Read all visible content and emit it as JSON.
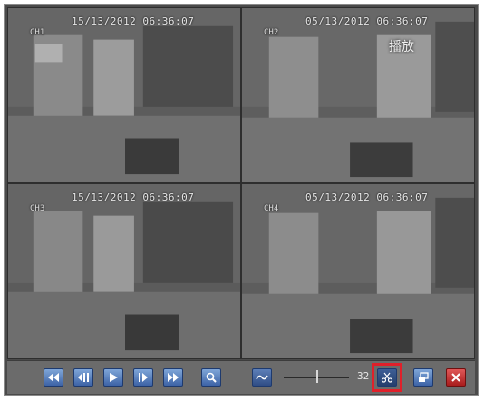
{
  "tiles": [
    {
      "timestamp": "15/13/2012 06:36:07",
      "channel": "CH1",
      "overlay_label": ""
    },
    {
      "timestamp": "05/13/2012 06:36:07",
      "channel": "CH2",
      "overlay_label": "播放"
    },
    {
      "timestamp": "15/13/2012 06:36:07",
      "channel": "CH3",
      "overlay_label": ""
    },
    {
      "timestamp": "05/13/2012 06:36:07",
      "channel": "CH4",
      "overlay_label": ""
    }
  ],
  "toolbar": {
    "buttons": [
      {
        "name": "rewind",
        "icon": "rewind-icon"
      },
      {
        "name": "prev-frame",
        "icon": "skip-back-icon"
      },
      {
        "name": "play",
        "icon": "play-icon"
      },
      {
        "name": "next-frame",
        "icon": "step-forward-icon"
      },
      {
        "name": "fast-forward",
        "icon": "fast-forward-icon"
      },
      {
        "name": "zoom",
        "icon": "magnifier-icon"
      },
      {
        "name": "clip",
        "icon": "scissors-icon"
      },
      {
        "name": "restore",
        "icon": "window-restore-icon"
      },
      {
        "name": "close",
        "icon": "close-icon"
      }
    ],
    "speed_value": "32"
  },
  "colors": {
    "button_blue": "#4f77b8",
    "highlight_red": "#e0202a",
    "close_red": "#c62828"
  }
}
